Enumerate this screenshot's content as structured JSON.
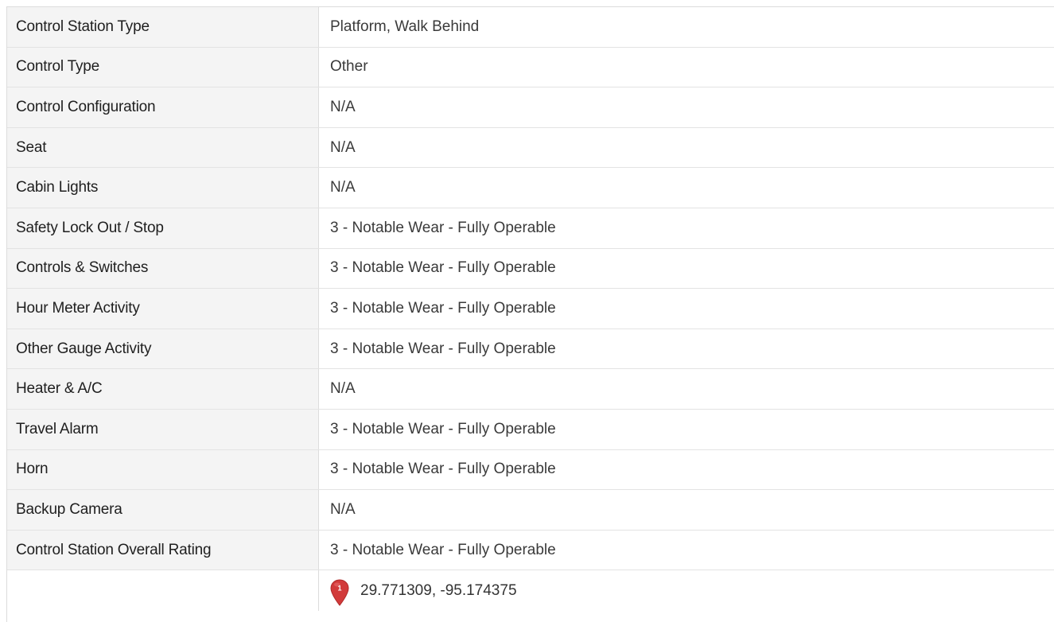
{
  "rows": [
    {
      "label": "Control Station Type",
      "value": "Platform, Walk Behind"
    },
    {
      "label": "Control Type",
      "value": "Other"
    },
    {
      "label": "Control Configuration",
      "value": "N/A"
    },
    {
      "label": "Seat",
      "value": "N/A"
    },
    {
      "label": "Cabin Lights",
      "value": "N/A"
    },
    {
      "label": "Safety Lock Out / Stop",
      "value": "3 - Notable Wear - Fully Operable"
    },
    {
      "label": "Controls & Switches",
      "value": "3 - Notable Wear - Fully Operable"
    },
    {
      "label": "Hour Meter Activity",
      "value": "3 - Notable Wear - Fully Operable"
    },
    {
      "label": "Other Gauge Activity",
      "value": "3 - Notable Wear - Fully Operable"
    },
    {
      "label": "Heater & A/C",
      "value": "N/A"
    },
    {
      "label": "Travel Alarm",
      "value": "3 - Notable Wear - Fully Operable"
    },
    {
      "label": "Horn",
      "value": "3 - Notable Wear - Fully Operable"
    },
    {
      "label": "Backup Camera",
      "value": "N/A"
    },
    {
      "label": "Control Station Overall Rating",
      "value": "3 - Notable Wear - Fully Operable"
    }
  ],
  "location": {
    "pin_number": "1",
    "coordinates": "29.771309, -95.174375",
    "pin_icon": "map-marker-icon",
    "pin_color": "#d23a3a"
  },
  "colors": {
    "label_bg": "#f4f4f4",
    "border": "#dcdcdc",
    "text": "#222222"
  }
}
